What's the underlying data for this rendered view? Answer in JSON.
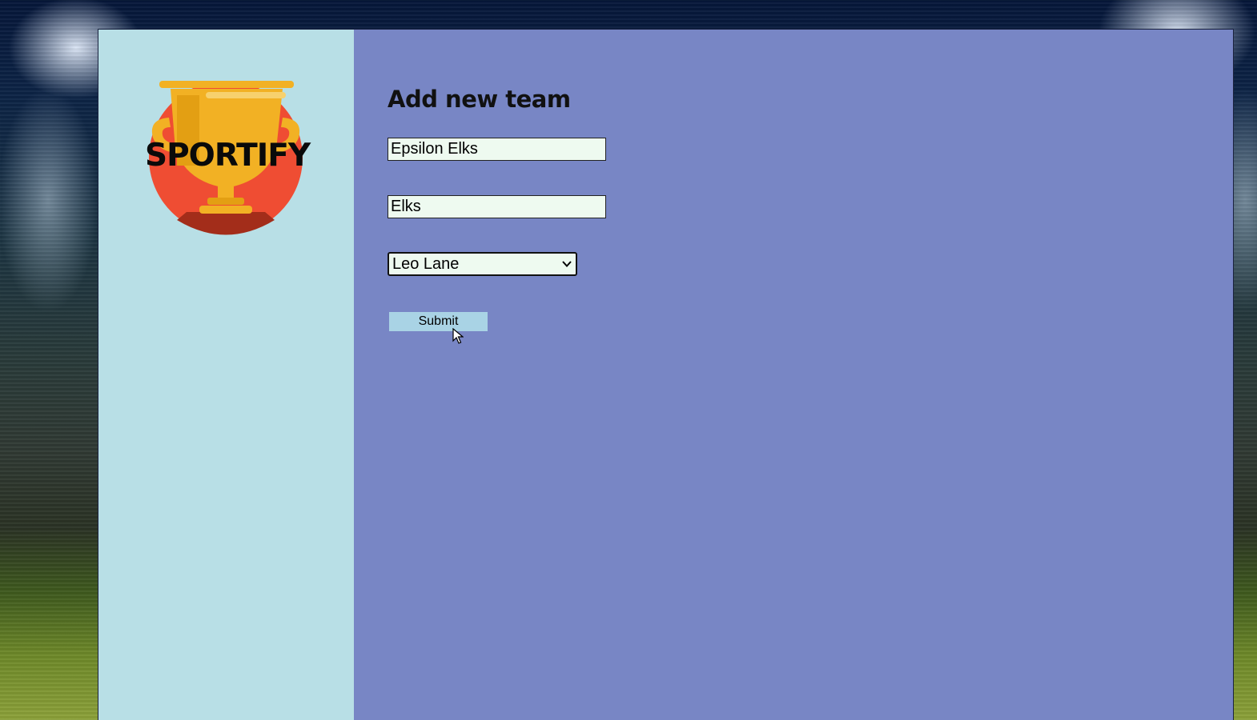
{
  "brand": {
    "logo_text": "SPORTIFY"
  },
  "form": {
    "title": "Add new team",
    "team_name_value": "Epsilon Elks",
    "team_short_value": "Elks",
    "coach_select_value": "Leo Lane",
    "submit_label": "Submit"
  },
  "colors": {
    "sidebar_bg": "#b8dfe6",
    "main_bg": "#7886c5",
    "input_bg": "#eefaf0",
    "button_bg": "#a9d3e5",
    "trophy_gold": "#f2b124",
    "logo_circle": "#ef4d33"
  },
  "icons": {
    "logo": "trophy-icon",
    "select_arrow": "chevron-down-icon",
    "pointer": "mouse-cursor-icon"
  }
}
